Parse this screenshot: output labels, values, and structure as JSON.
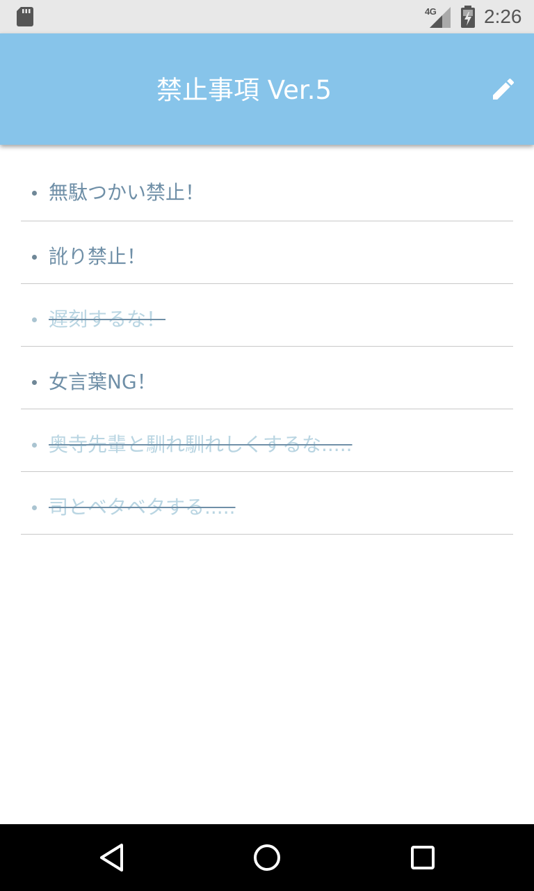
{
  "status_bar": {
    "left_icon": "sd-card-icon",
    "network": "4G",
    "signal_icon": "cell-signal-icon",
    "battery_icon": "battery-charging-icon",
    "time": "2:26"
  },
  "app_bar": {
    "title": "禁止事項 Ver.5",
    "edit_icon": "pencil-icon",
    "background_color": "#87c4ea"
  },
  "rules": [
    {
      "text": "無駄つかい禁止！",
      "done": false
    },
    {
      "text": "訛り禁止！",
      "done": false
    },
    {
      "text": "遅刻するな！",
      "done": true
    },
    {
      "text": "女言葉NG！",
      "done": false
    },
    {
      "text": "奥寺先輩と馴れ馴れしくするな.....",
      "done": true
    },
    {
      "text": "司とベタベタする.....",
      "done": true
    }
  ],
  "nav_bar": {
    "back_icon": "back-triangle-icon",
    "home_icon": "home-circle-icon",
    "recents_icon": "recents-square-icon"
  }
}
